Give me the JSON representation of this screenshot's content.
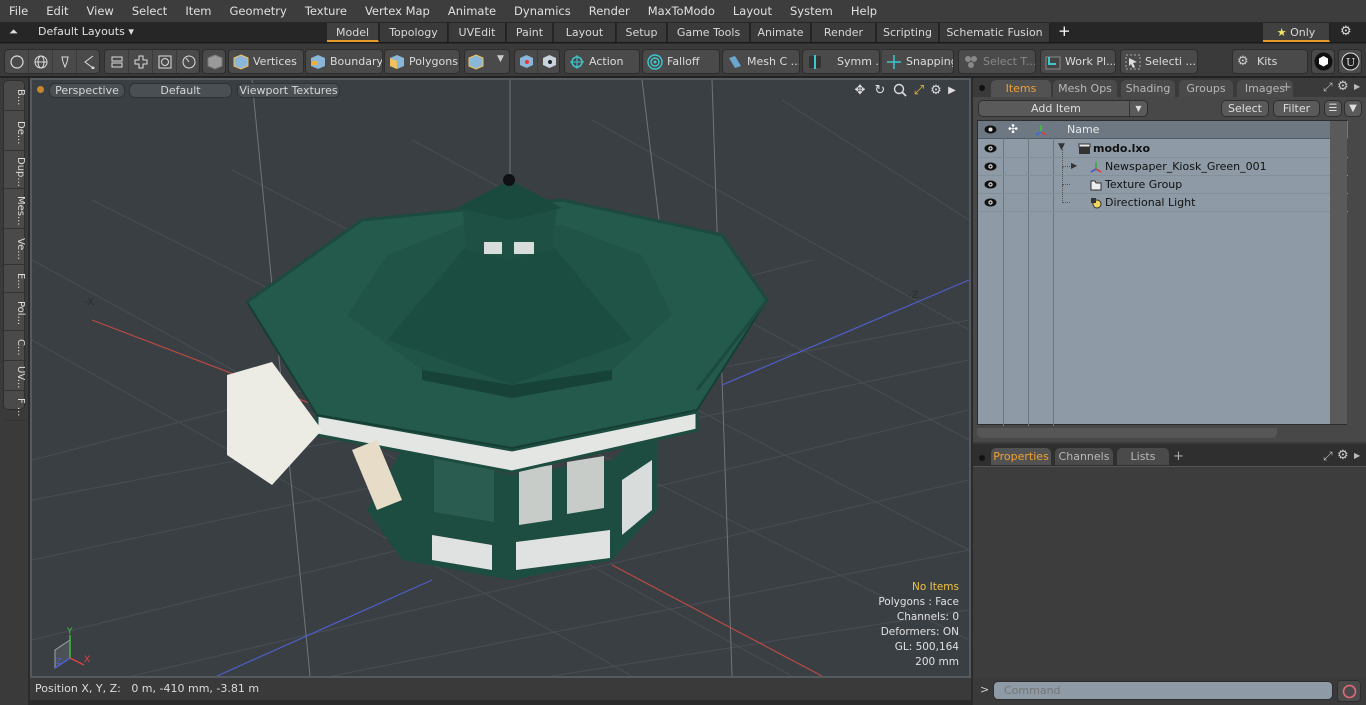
{
  "menubar": {
    "items": [
      "File",
      "Edit",
      "View",
      "Select",
      "Item",
      "Geometry",
      "Texture",
      "Vertex Map",
      "Animate",
      "Dynamics",
      "Render",
      "MaxToModo",
      "Layout",
      "System",
      "Help"
    ]
  },
  "layoutbar": {
    "layouts_label": "Default Layouts",
    "tabs": [
      "Model",
      "Topology",
      "UVEdit",
      "Paint",
      "Layout",
      "Setup",
      "Game Tools",
      "Animate",
      "Render",
      "Scripting",
      "Schematic Fusion"
    ],
    "active_tab": "Model",
    "only_label": "Only"
  },
  "toolbar": {
    "vertices": "Vertices",
    "boundary": "Boundary",
    "polygons": "Polygons",
    "action": "Action",
    "falloff": "Falloff",
    "mesh_c": "Mesh C ...",
    "symm": "Symm ...",
    "snapping": "Snapping",
    "select_t": "Select T...",
    "work_pl": "Work Pl...",
    "selecti": "Selecti ...",
    "kits": "Kits",
    "ellipsis": "..."
  },
  "left_tabs": [
    "B...",
    "De...",
    "Dup...",
    "Mes...",
    "Ve...",
    "E...",
    "Pol...",
    "C...",
    "UV...",
    "F ..."
  ],
  "viewport": {
    "perspective": "Perspective",
    "default": "Default",
    "viewport_textures": "Viewport Textures",
    "axis_neg_x": "-X",
    "axis_neg_z": "-Z",
    "gizmo": {
      "x": "X",
      "y": "Y",
      "z": "Z"
    },
    "status": {
      "selection": "No Items",
      "polygons": "Polygons : Face",
      "channels": "Channels: 0",
      "deformers": "Deformers: ON",
      "gl": "GL: 500,164",
      "scale": "200 mm"
    },
    "colors": {
      "kiosk_green": "#1f5548",
      "panel_white": "#e6e8e6",
      "axis_x": "#c0473f",
      "axis_z": "#4a5bc4"
    }
  },
  "position_bar": {
    "label": "Position X, Y, Z:",
    "value": "0 m, -410 mm, -3.81 m"
  },
  "items_panel": {
    "tabs": [
      "Items",
      "Mesh Ops",
      "Shading",
      "Groups",
      "Images"
    ],
    "active_tab": "Items",
    "add_item": "Add Item",
    "select": "Select",
    "filter": "Filter",
    "column_name": "Name",
    "rows": [
      {
        "name": "modo.lxo",
        "bold": true,
        "icon": "scene-icon"
      },
      {
        "name": "Newspaper_Kiosk_Green_001",
        "bold": false,
        "icon": "mesh-locator-icon"
      },
      {
        "name": "Texture Group",
        "bold": false,
        "icon": "texture-group-icon"
      },
      {
        "name": "Directional Light",
        "bold": false,
        "icon": "light-icon"
      }
    ]
  },
  "properties_panel": {
    "tabs": [
      "Properties",
      "Channels",
      "Lists"
    ],
    "active_tab": "Properties"
  },
  "command_bar": {
    "prompt": ">",
    "placeholder": "Command"
  }
}
